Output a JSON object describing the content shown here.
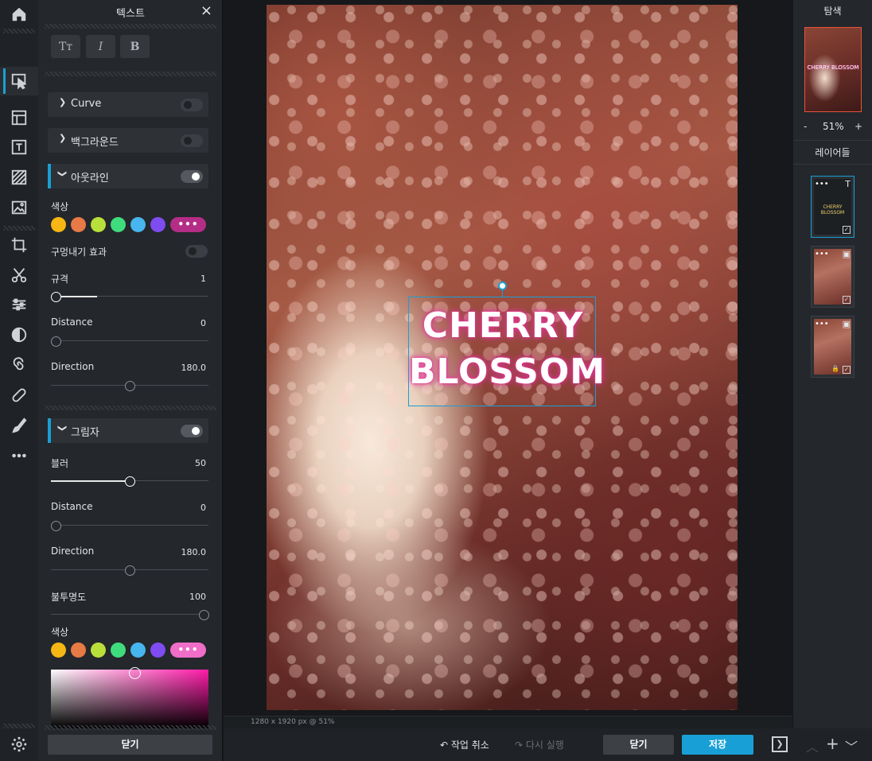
{
  "toolbar": {
    "icons": [
      "home-icon",
      "select-icon",
      "layout-icon",
      "text-icon",
      "pattern-icon",
      "image-icon",
      "crop-icon",
      "cut-icon",
      "adjust-icon",
      "contrast-icon",
      "swirl-icon",
      "bandage-icon",
      "brush-icon",
      "more-icon",
      "settings-icon"
    ]
  },
  "text_panel": {
    "title": "텍스트",
    "close": "×",
    "format_buttons": [
      "Tт",
      "I",
      "B"
    ],
    "curve": {
      "label": "Curve",
      "enabled": false
    },
    "background": {
      "label": "백그라운드",
      "enabled": false
    },
    "outline": {
      "label": "아웃라인",
      "enabled": true,
      "color_label": "색상",
      "more_label": "•••",
      "more_color": "#b42d86",
      "knockout_label": "구멍내기 효과",
      "knockout_enabled": false,
      "size_label": "규격",
      "size_value": "1",
      "size_fraction": 0.0,
      "distance_label": "Distance",
      "distance_value": "0",
      "direction_label": "Direction",
      "direction_value": "180.0"
    },
    "shadow": {
      "label": "그림자",
      "enabled": true,
      "blur_label": "블러",
      "blur_value": "50",
      "blur_fraction": 0.5,
      "distance_label": "Distance",
      "distance_value": "0",
      "direction_label": "Direction",
      "direction_value": "180.0",
      "opacity_label": "불투명도",
      "opacity_value": "100",
      "opacity_fraction": 1.0,
      "color_label": "색상",
      "more_label": "•••",
      "more_color": "#f06dc8"
    },
    "swatch_colors": [
      "#f6b614",
      "#e87a45",
      "#b9df3b",
      "#3fdc7e",
      "#47b5ee",
      "#7e4cf0"
    ],
    "close_button": "닫기"
  },
  "canvas": {
    "text_line1": "CHERRY",
    "text_line2": "BLOSSOM",
    "status": "1280 x 1920 px @ 51%"
  },
  "right_panel": {
    "navigator_title": "탐색",
    "zoom_minus": "-",
    "zoom_value": "51%",
    "zoom_plus": "+",
    "thumb_text": "CHERRY BLOSSOM",
    "layers_title": "레이어들",
    "layer_text": "CHERRY BLOSSOM",
    "layer_more": "•••",
    "layer_text_type": "T"
  },
  "bottom_bar": {
    "undo": "작업 취소",
    "redo": "다시 실행",
    "close": "닫기",
    "save": "저장"
  },
  "colors": {
    "accent": "#18a0d6",
    "save": "#18a0d6"
  }
}
